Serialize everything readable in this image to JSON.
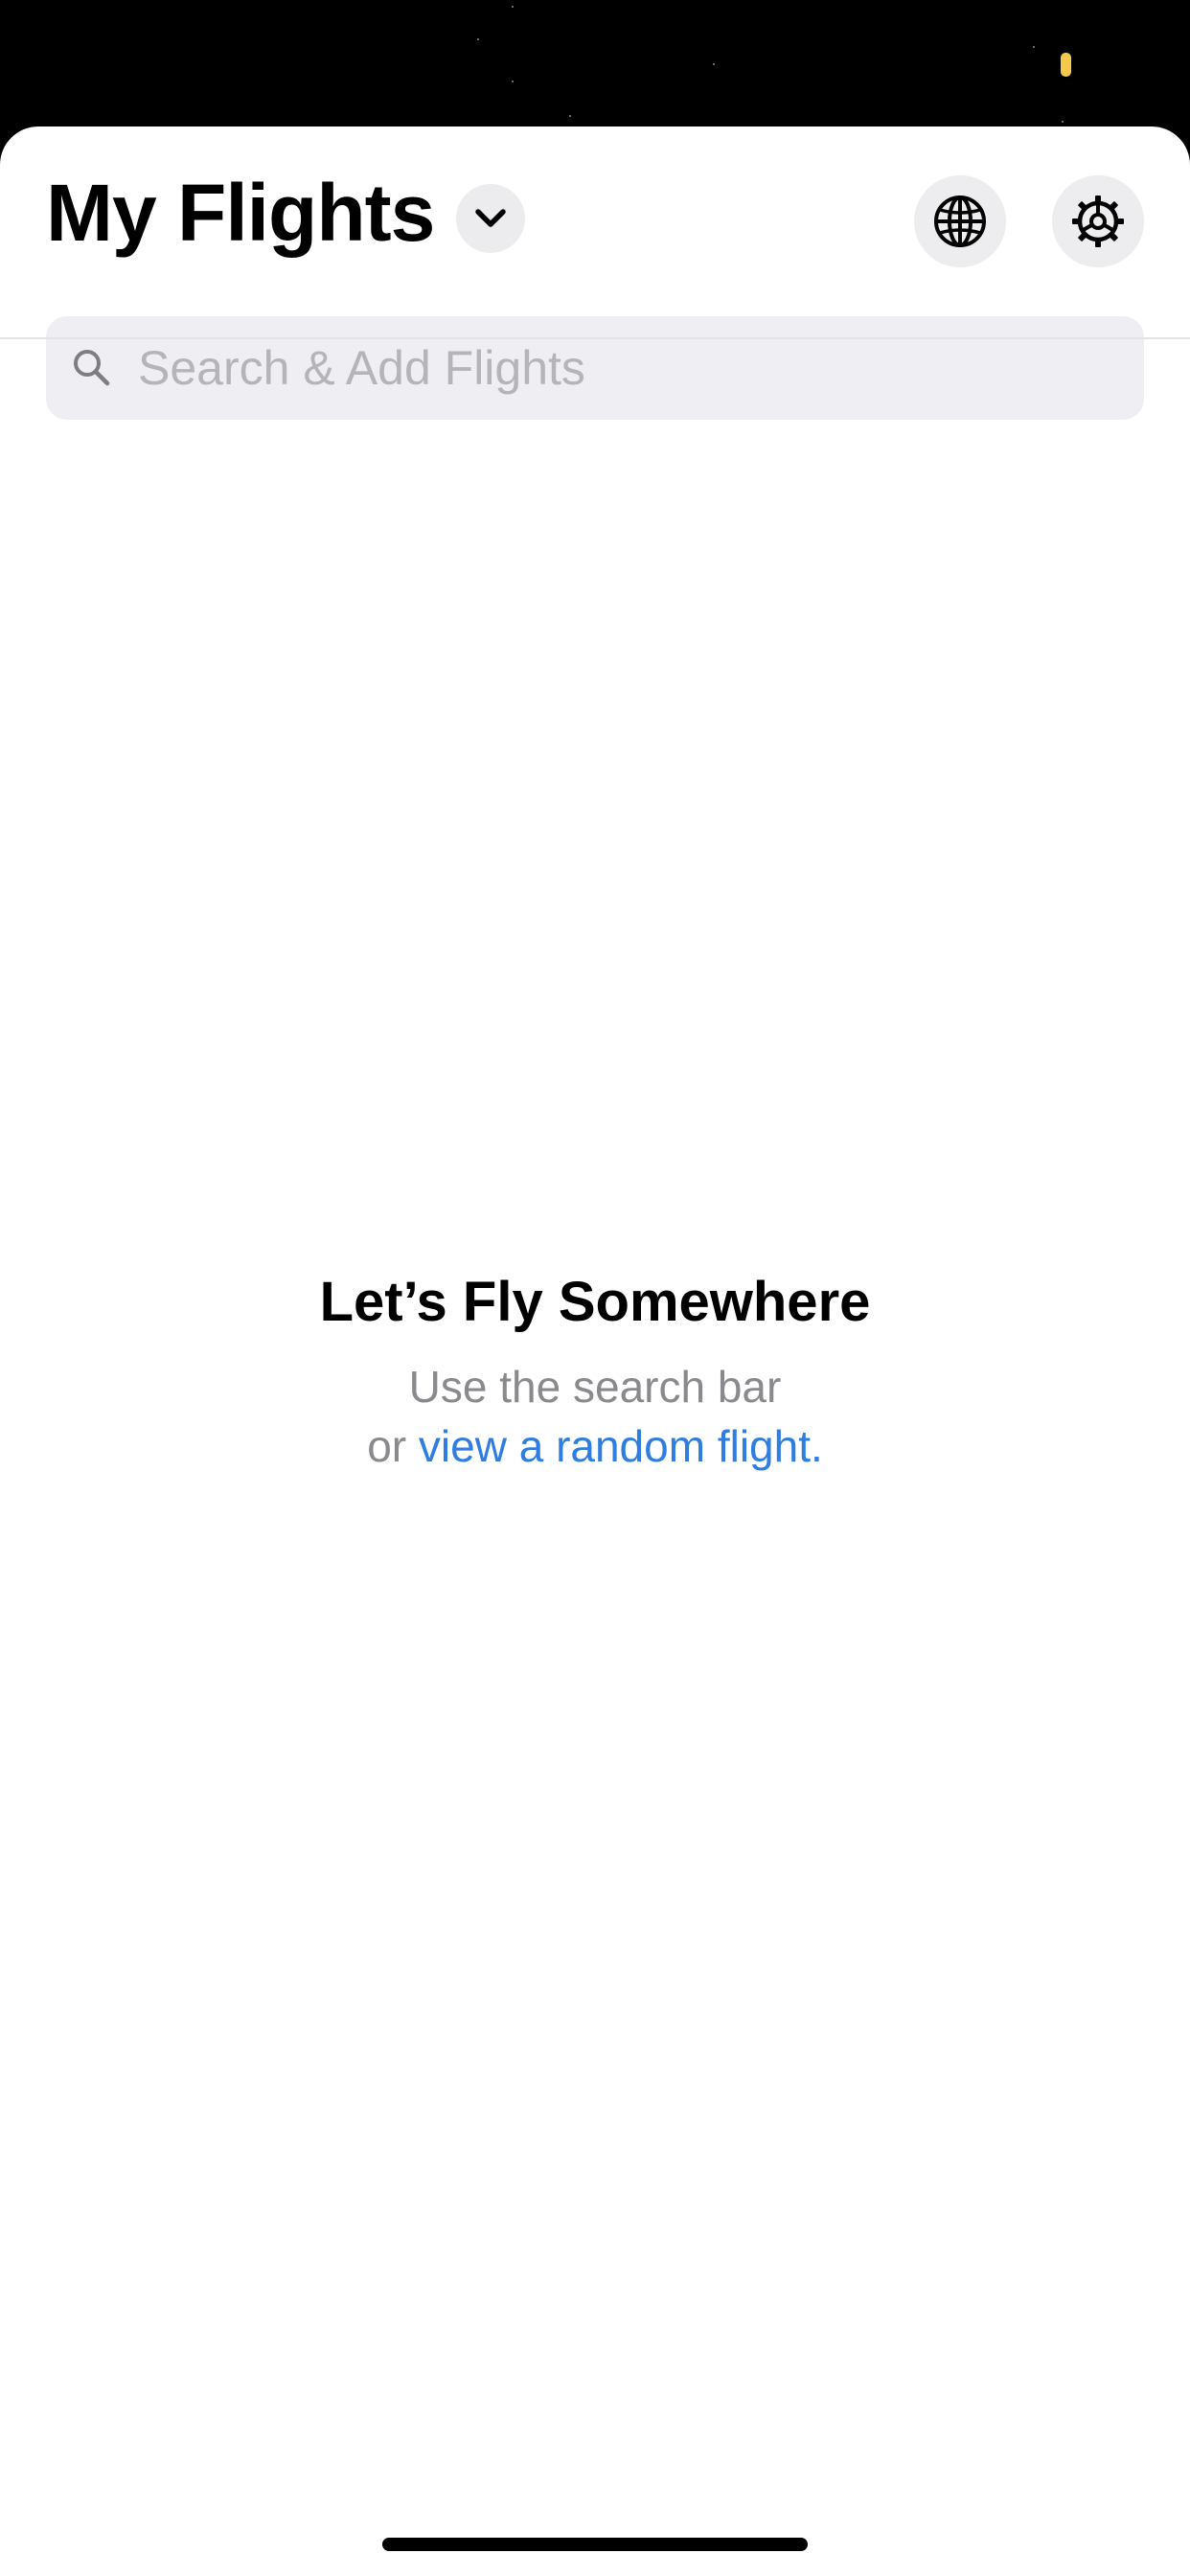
{
  "header": {
    "title": "My Flights",
    "dropdown_icon": "chevron-down-icon",
    "globe_icon": "globe-icon",
    "settings_icon": "gear-icon"
  },
  "search": {
    "placeholder": "Search & Add Flights",
    "value": "",
    "icon": "search-icon"
  },
  "empty_state": {
    "title": "Let’s Fly Somewhere",
    "line1": "Use the search bar",
    "line2_prefix": "or ",
    "link_text": "view a random flight."
  },
  "colors": {
    "accent": "#2f7de1",
    "indicator": "#f4c94a",
    "background": "#000000",
    "sheet": "#ffffff"
  }
}
